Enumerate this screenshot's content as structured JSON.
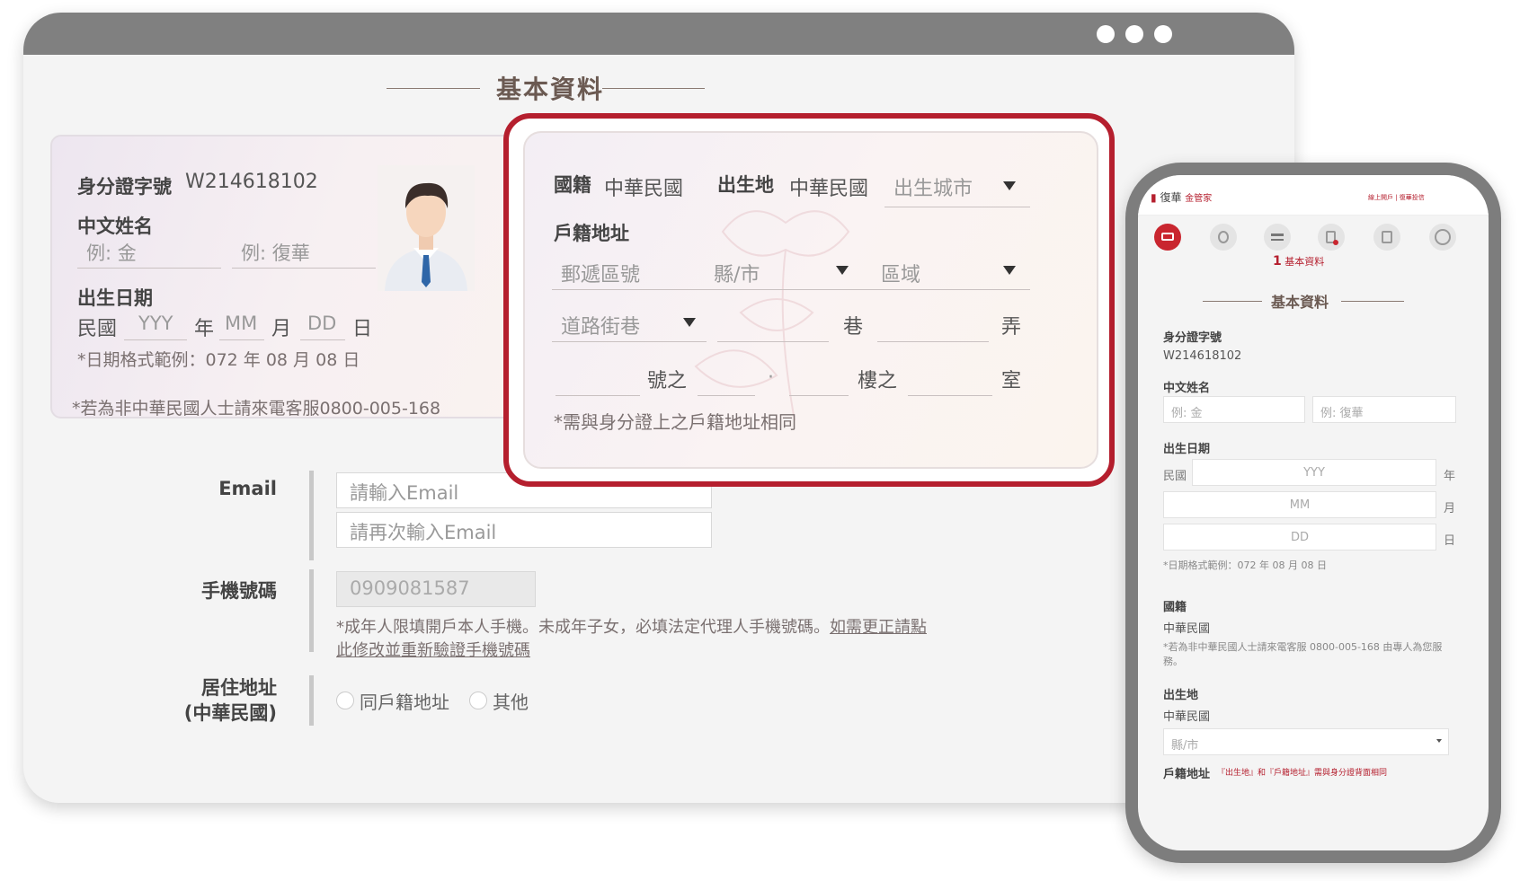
{
  "section_title": "基本資料",
  "id_card": {
    "id_label": "身分證字號",
    "id_value": "W214618102",
    "name_label": "中文姓名",
    "surname_placeholder": "例: 金",
    "given_placeholder": "例: 復華",
    "dob_label": "出生日期",
    "era": "民國",
    "year_ph": "YYY",
    "year_unit": "年",
    "month_ph": "MM",
    "month_unit": "月",
    "day_ph": "DD",
    "day_unit": "日",
    "date_note": "*日期格式範例：072 年 08 月 08 日"
  },
  "foreign_note": "*若為非中華民國人士請來電客服0800-005-168",
  "address_panel": {
    "nationality_label": "國籍",
    "nationality_value": "中華民國",
    "birthplace_label": "出生地",
    "birthplace_value": "中華民國",
    "birth_city_ph": "出生城市",
    "household_label": "戶籍地址",
    "postal_ph": "郵遞區號",
    "county_ph": "縣/市",
    "district_ph": "區域",
    "road_ph": "道路街巷",
    "lane_unit": "巷",
    "alley_unit": "弄",
    "number_unit": "號之",
    "dot": "·",
    "floor_unit": "樓之",
    "room_unit": "室",
    "note": "*需與身分證上之戶籍地址相同"
  },
  "form": {
    "email_label": "Email",
    "email_ph": "請輸入Email",
    "email2_ph": "請再次輸入Email",
    "mobile_label": "手機號碼",
    "mobile_value": "0909081587",
    "mobile_note_1": "*成年人限填開戶本人手機。未成年子女，必填法定代理人手機號碼。",
    "mobile_link_1": "如需更正請點",
    "mobile_link_2": "此修改並重新驗證手機號碼",
    "address_label_1": "居住地址",
    "address_label_2": "(中華民國)",
    "radio_same": "同戶籍地址",
    "radio_other": "其他"
  },
  "phone": {
    "brand_name": "復華",
    "brand_sub": "金管家",
    "header_right": "線上開戶 | 復華投信",
    "step_num": "1",
    "step_label": "基本資料",
    "section_title": "基本資料",
    "id_label": "身分證字號",
    "id_value": "W214618102",
    "name_label": "中文姓名",
    "surname_ph": "例: 金",
    "given_ph": "例: 復華",
    "dob_label": "出生日期",
    "era": "民國",
    "year_ph": "YYY",
    "year_unit": "年",
    "month_ph": "MM",
    "month_unit": "月",
    "day_ph": "DD",
    "day_unit": "日",
    "date_note": "*日期格式範例：072 年 08 月 08 日",
    "nationality_label": "國籍",
    "nationality_value": "中華民國",
    "foreign_note": "*若為非中華民國人士請來電客服 0800-005-168 由專人為您服務。",
    "birthplace_label": "出生地",
    "birthplace_value": "中華民國",
    "county_ph": "縣/市",
    "household_label": "戶籍地址",
    "household_note": "『出生地』和『戶籍地址』需與身分證背面相同"
  },
  "colors": {
    "accent": "#b51f2e",
    "title": "#6b5a52",
    "frame": "#808080"
  }
}
